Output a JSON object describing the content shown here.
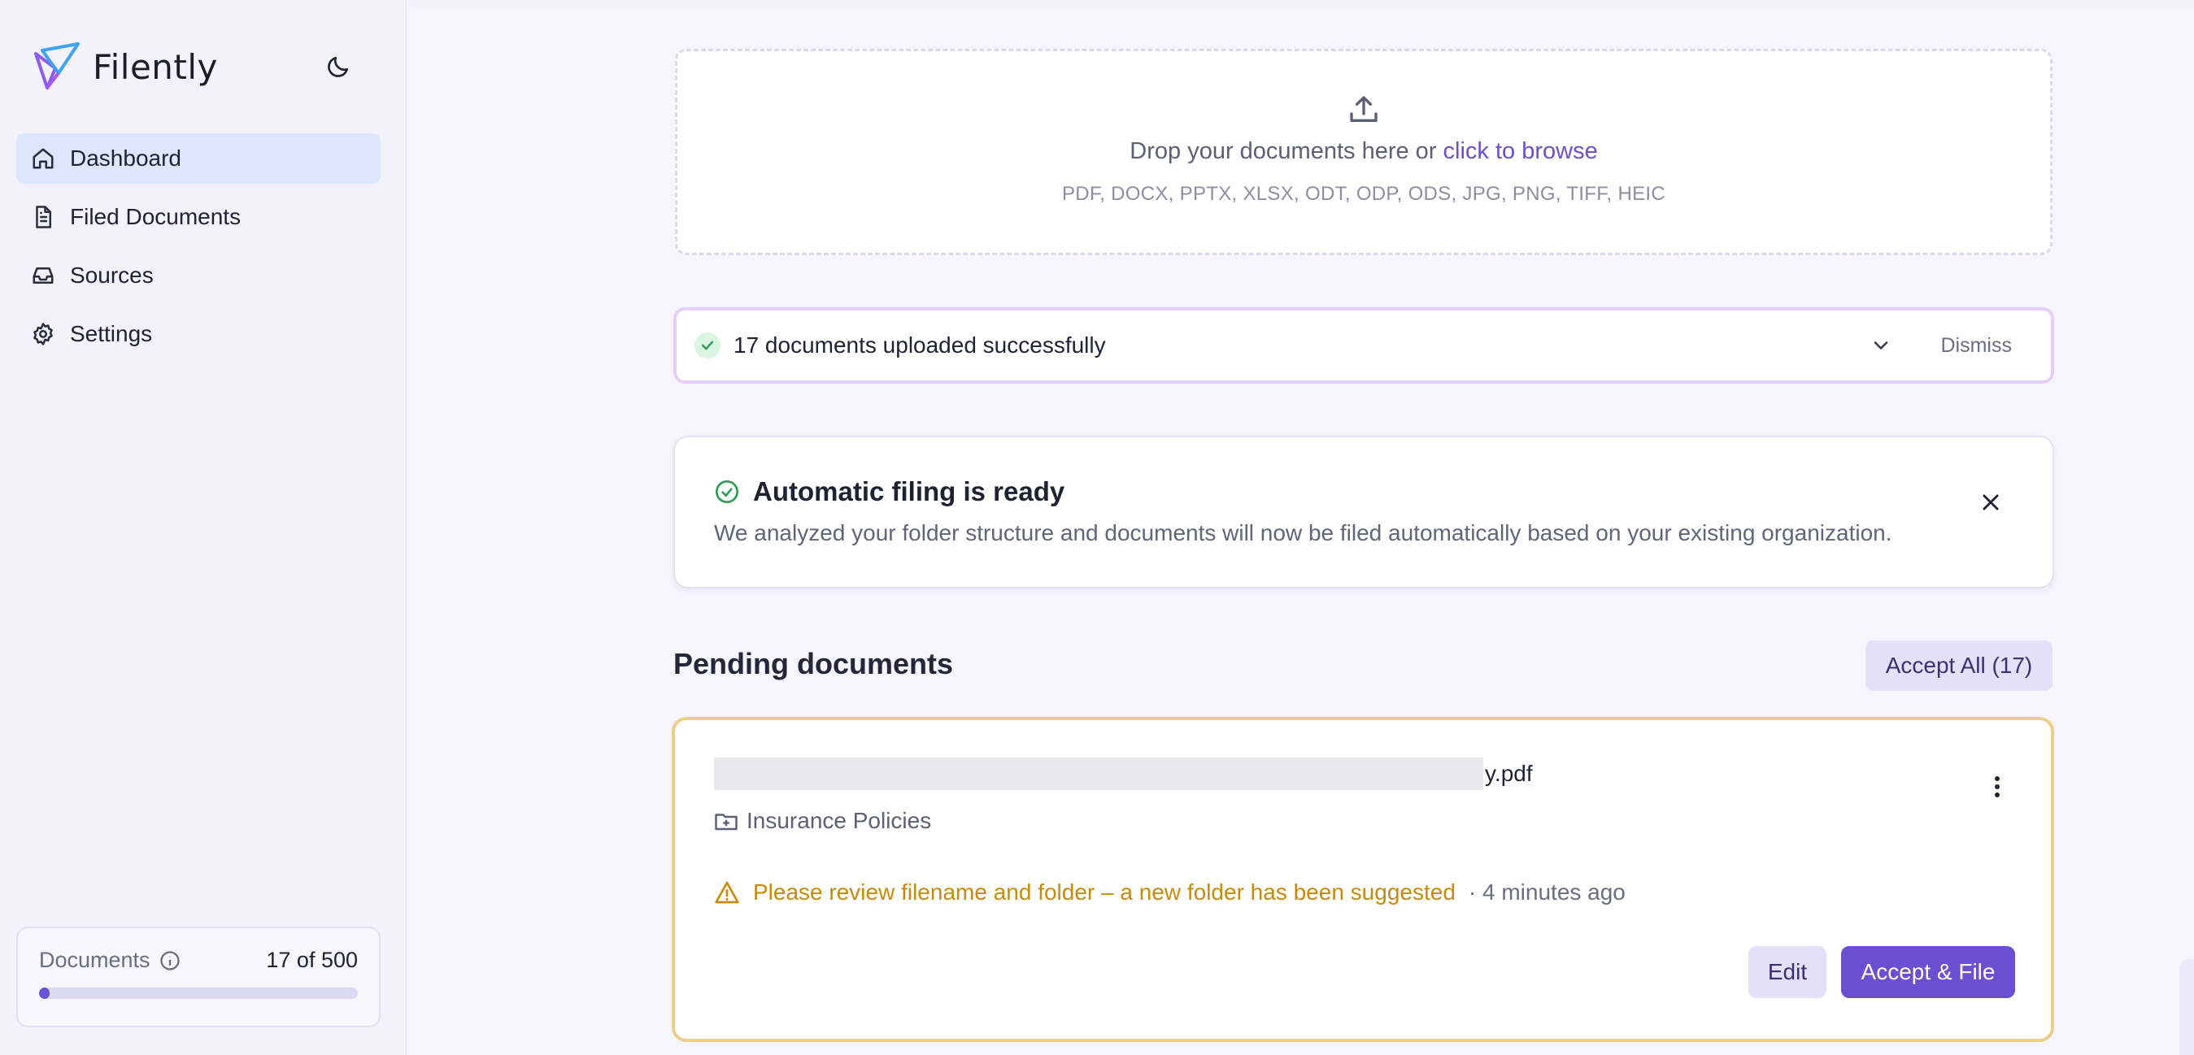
{
  "app": {
    "name": "Filently",
    "brand_colors": {
      "accent": "#6c4fd1",
      "logo_blue": "#3ea3f3",
      "logo_purple": "#8b5cf6"
    }
  },
  "sidebar": {
    "theme_toggle_icon": "moon-icon",
    "items": [
      {
        "label": "Dashboard",
        "icon": "home-icon",
        "active": true
      },
      {
        "label": "Filed Documents",
        "icon": "document-icon",
        "active": false
      },
      {
        "label": "Sources",
        "icon": "inbox-icon",
        "active": false
      },
      {
        "label": "Settings",
        "icon": "gear-icon",
        "active": false
      }
    ],
    "usage": {
      "label": "Documents",
      "count": "17 of 500",
      "used": 17,
      "limit": 500
    }
  },
  "dropzone": {
    "text": "Drop your documents here or ",
    "link": "click to browse",
    "formats": "PDF, DOCX, PPTX, XLSX, ODT, ODP, ODS, JPG, PNG, TIFF, HEIC"
  },
  "upload_banner": {
    "text": "17 documents uploaded successfully",
    "dismiss": "Dismiss"
  },
  "auto_filing": {
    "title": "Automatic filing is ready",
    "description": "We analyzed your folder structure and documents will now be filed automatically based on your existing organization."
  },
  "pending": {
    "title": "Pending documents",
    "accept_all": "Accept All (17)",
    "documents": [
      {
        "filename_suffix": "y.pdf",
        "folder": "Insurance Policies",
        "warning": "Please review filename and folder – a new folder has been suggested",
        "time": "· 4 minutes ago",
        "edit_label": "Edit",
        "accept_label": "Accept & File"
      }
    ]
  }
}
